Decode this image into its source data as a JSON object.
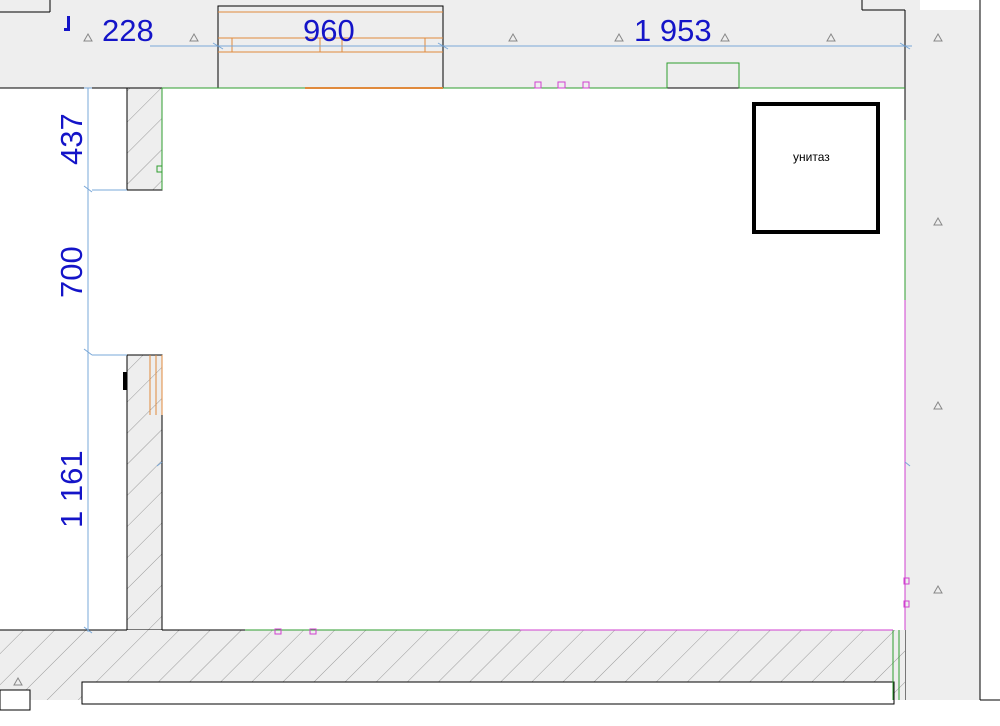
{
  "dimensions": {
    "top": [
      "228",
      "960",
      "1 953"
    ],
    "left": [
      "437",
      "700",
      "1 161"
    ]
  },
  "fixtures": {
    "toilet_label": "унитаз"
  },
  "colors": {
    "dimension_text": "#1414c8",
    "dimension_line": "#7aa8d8",
    "wall_fill": "#eeeeee",
    "wall_outline": "#000000",
    "hatch": "#9a9a9a",
    "door_window": "#e08a3c",
    "green_line": "#2e9e2e",
    "magenta_line": "#d040d0"
  }
}
